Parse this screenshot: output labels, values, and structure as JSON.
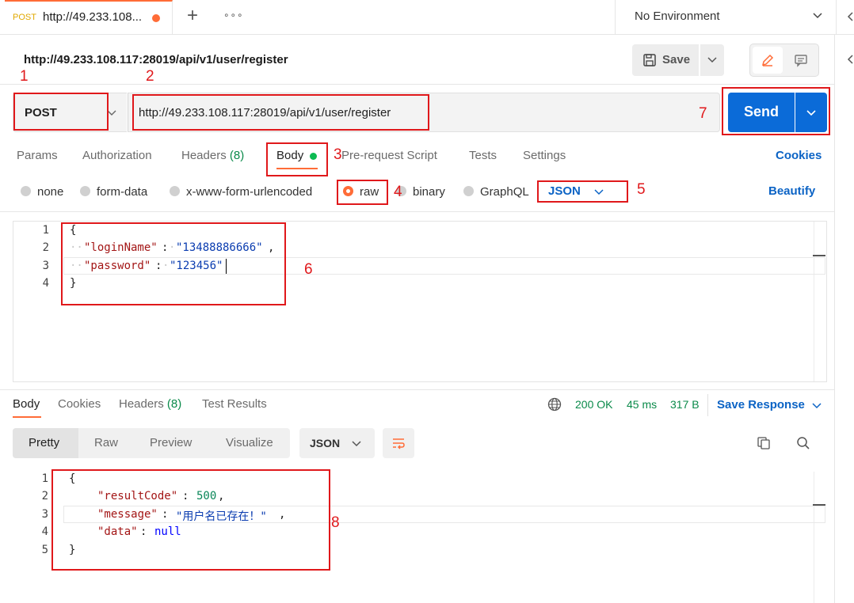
{
  "tab": {
    "method": "POST",
    "url": "http://49.233.108...",
    "add_symbol": "+",
    "more_symbol": "∘∘∘"
  },
  "environment": {
    "label": "No Environment"
  },
  "request": {
    "title": "http://49.233.108.117:28019/api/v1/user/register",
    "save_label": "Save",
    "method": "POST",
    "url": "http://49.233.108.117:28019/api/v1/user/register",
    "send_label": "Send"
  },
  "request_tabs": {
    "params": "Params",
    "authorization": "Authorization",
    "headers": "Headers",
    "headers_count": "(8)",
    "body": "Body",
    "prerequest": "Pre-request Script",
    "tests": "Tests",
    "settings": "Settings",
    "cookies": "Cookies"
  },
  "body_types": {
    "none": "none",
    "form_data": "form-data",
    "urlencoded": "x-www-form-urlencoded",
    "raw": "raw",
    "binary": "binary",
    "graphql": "GraphQL",
    "format": "JSON",
    "beautify": "Beautify"
  },
  "request_body": {
    "line_numbers": [
      "1",
      "2",
      "3",
      "4"
    ],
    "open": "{",
    "k1": "\"loginName\"",
    "v1": "\"13488886666\"",
    "k2": "\"password\"",
    "v2": "\"123456\"",
    "close": "}"
  },
  "response_tabs": {
    "body": "Body",
    "cookies": "Cookies",
    "headers": "Headers",
    "headers_count": "(8)",
    "test_results": "Test Results"
  },
  "response_meta": {
    "status": "200 OK",
    "time": "45 ms",
    "size": "317 B",
    "save_response": "Save Response"
  },
  "response_view": {
    "pretty": "Pretty",
    "raw": "Raw",
    "preview": "Preview",
    "visualize": "Visualize",
    "format": "JSON"
  },
  "response_body": {
    "line_numbers": [
      "1",
      "2",
      "3",
      "4",
      "5"
    ],
    "open": "{",
    "k1": "\"resultCode\"",
    "v1": "500",
    "k2": "\"message\"",
    "v2": "\"用户名已存在！\"",
    "k3": "\"data\"",
    "v3": "null",
    "close": "}"
  },
  "annotations": [
    "1",
    "2",
    "3",
    "4",
    "5",
    "6",
    "7",
    "8"
  ],
  "colors": {
    "accent": "#ff6c37",
    "send": "#0b6bd8",
    "link": "#0b63c5",
    "status_ok": "#0a8a4a",
    "annotation": "#e0181b"
  }
}
